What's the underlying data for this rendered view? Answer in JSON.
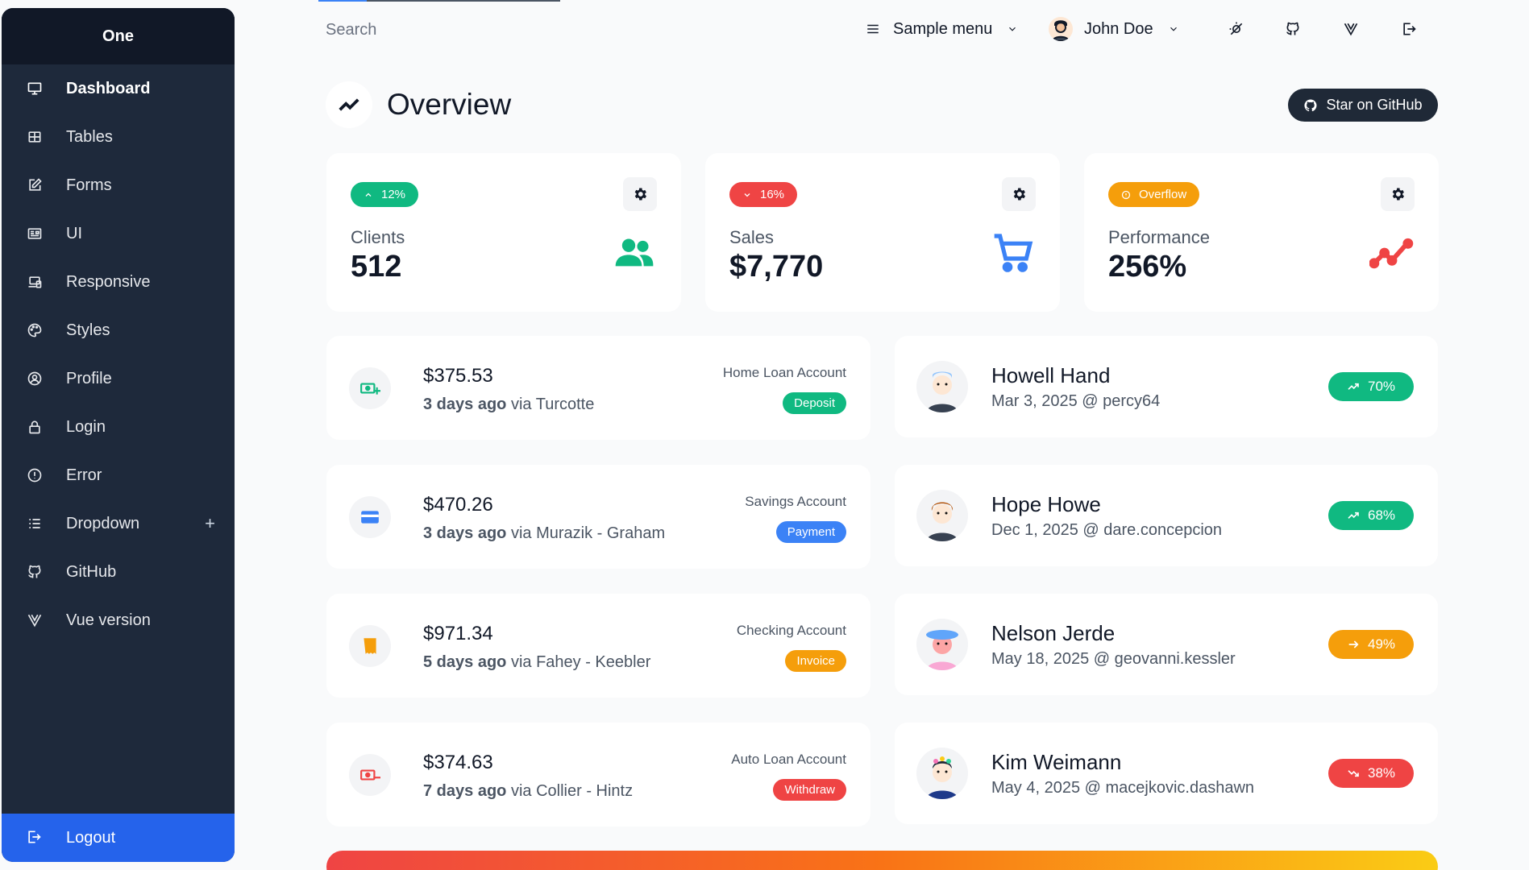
{
  "brand": "One",
  "sidebar": {
    "items": [
      {
        "label": "Dashboard",
        "icon": "monitor-icon"
      },
      {
        "label": "Tables",
        "icon": "table-icon"
      },
      {
        "label": "Forms",
        "icon": "edit-icon"
      },
      {
        "label": "UI",
        "icon": "ui-icon"
      },
      {
        "label": "Responsive",
        "icon": "responsive-icon"
      },
      {
        "label": "Styles",
        "icon": "palette-icon"
      },
      {
        "label": "Profile",
        "icon": "user-icon"
      },
      {
        "label": "Login",
        "icon": "lock-icon"
      },
      {
        "label": "Error",
        "icon": "alert-icon"
      },
      {
        "label": "Dropdown",
        "icon": "list-icon"
      },
      {
        "label": "GitHub",
        "icon": "github-icon"
      },
      {
        "label": "Vue version",
        "icon": "vue-icon"
      }
    ],
    "logout_label": "Logout"
  },
  "topbar": {
    "search_placeholder": "Search",
    "sample_menu_label": "Sample menu",
    "user_name": "John Doe"
  },
  "page": {
    "title": "Overview",
    "github_button_label": "Star on GitHub"
  },
  "stats": [
    {
      "badge": "12%",
      "badge_color": "#10b981",
      "label": "Clients",
      "value": "512",
      "icon_color": "#10b981"
    },
    {
      "badge": "16%",
      "badge_color": "#ef4444",
      "label": "Sales",
      "value": "$7,770",
      "icon_color": "#3b82f6"
    },
    {
      "badge": "Overflow",
      "badge_color": "#f59e0b",
      "label": "Performance",
      "value": "256%",
      "icon_color": "#ef4444"
    }
  ],
  "transactions": [
    {
      "amount": "$375.53",
      "ago": "3 days ago",
      "via": "via Turcotte",
      "account": "Home Loan Account",
      "tag": "Deposit",
      "tag_color": "#10b981"
    },
    {
      "amount": "$470.26",
      "ago": "3 days ago",
      "via": "via Murazik - Graham",
      "account": "Savings Account",
      "tag": "Payment",
      "tag_color": "#3b82f6"
    },
    {
      "amount": "$971.34",
      "ago": "5 days ago",
      "via": "via Fahey - Keebler",
      "account": "Checking Account",
      "tag": "Invoice",
      "tag_color": "#f59e0b"
    },
    {
      "amount": "$374.63",
      "ago": "7 days ago",
      "via": "via Collier - Hintz",
      "account": "Auto Loan Account",
      "tag": "Withdraw",
      "tag_color": "#ef4444"
    }
  ],
  "clients": [
    {
      "name": "Howell Hand",
      "sub": "Mar 3, 2025 @ percy64",
      "progress": "70%",
      "pill_color": "#10b981",
      "trend": "up"
    },
    {
      "name": "Hope Howe",
      "sub": "Dec 1, 2025 @ dare.concepcion",
      "progress": "68%",
      "pill_color": "#10b981",
      "trend": "up"
    },
    {
      "name": "Nelson Jerde",
      "sub": "May 18, 2025 @ geovanni.kessler",
      "progress": "49%",
      "pill_color": "#f59e0b",
      "trend": "flat"
    },
    {
      "name": "Kim Weimann",
      "sub": "May 4, 2025 @ macejkovic.dashawn",
      "progress": "38%",
      "pill_color": "#ef4444",
      "trend": "down"
    }
  ]
}
